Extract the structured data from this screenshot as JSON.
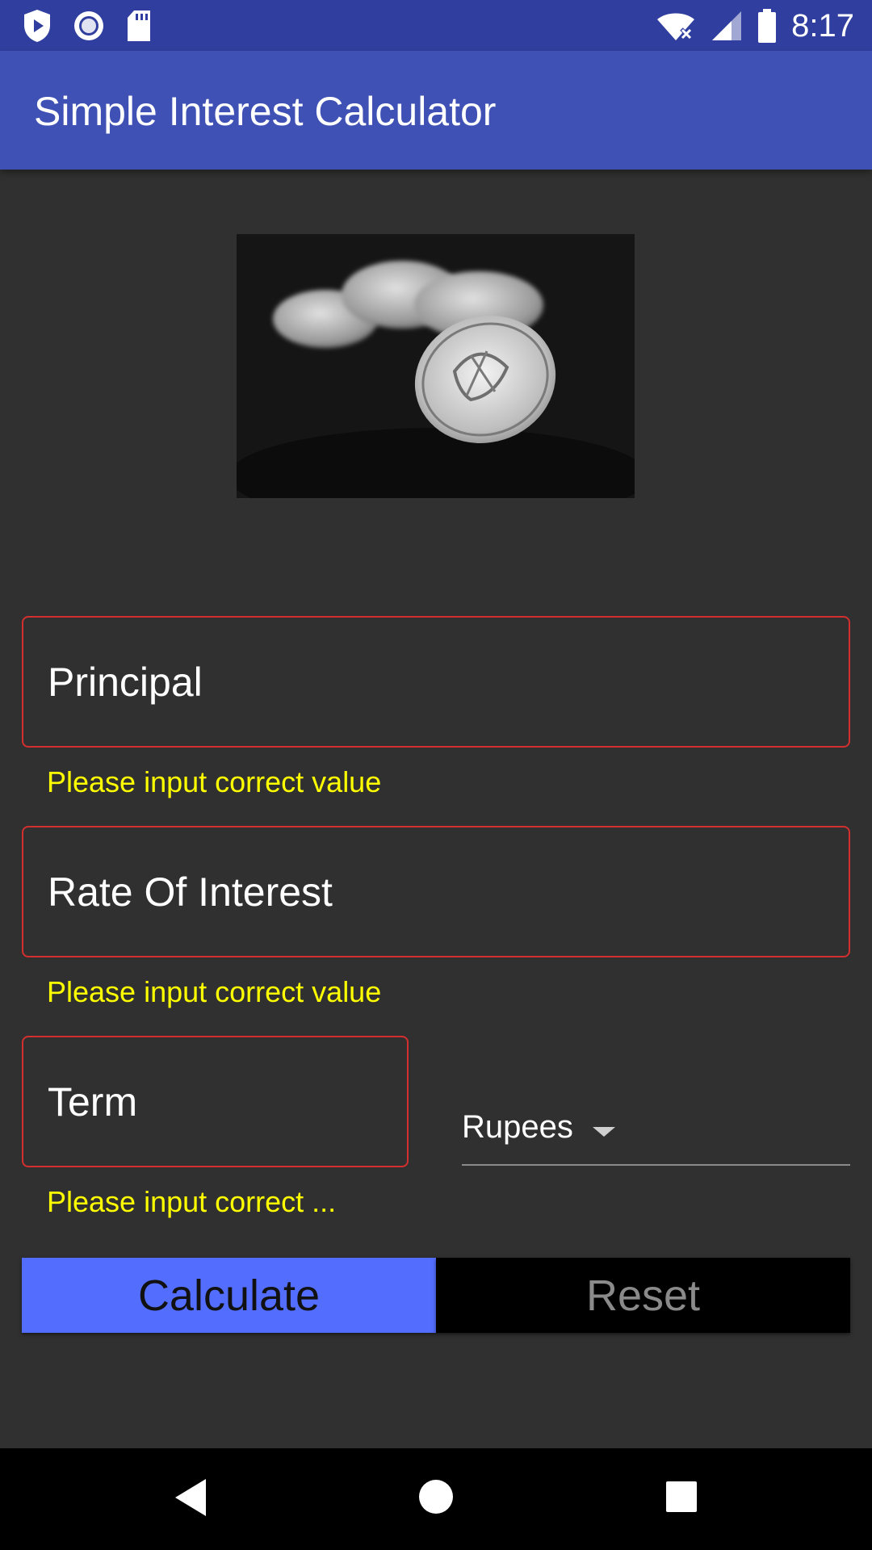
{
  "status_bar": {
    "time": "8:17",
    "icons_left": [
      "shield-play-icon",
      "radio-circle-icon",
      "sd-card-icon"
    ],
    "icons_right": [
      "wifi-off-icon",
      "signal-icon",
      "battery-icon"
    ]
  },
  "app_bar": {
    "title": "Simple Interest Calculator"
  },
  "form": {
    "principal": {
      "placeholder": "Principal",
      "error": "Please input correct value"
    },
    "rate": {
      "placeholder": "Rate Of Interest",
      "error": "Please input correct value"
    },
    "term": {
      "placeholder": "Term",
      "error": "Please input correct ..."
    },
    "currency": {
      "selected": "Rupees"
    }
  },
  "buttons": {
    "calculate": "Calculate",
    "reset": "Reset"
  },
  "nav": {
    "back": "back-icon",
    "home": "home-icon",
    "recents": "recents-icon"
  },
  "colors": {
    "status_bar": "#303f9f",
    "app_bar": "#3f51b5",
    "background": "#303030",
    "error_border": "#d32f2f",
    "error_text": "#ffff00",
    "calculate_bg": "#536dfe",
    "reset_bg": "#000000"
  }
}
